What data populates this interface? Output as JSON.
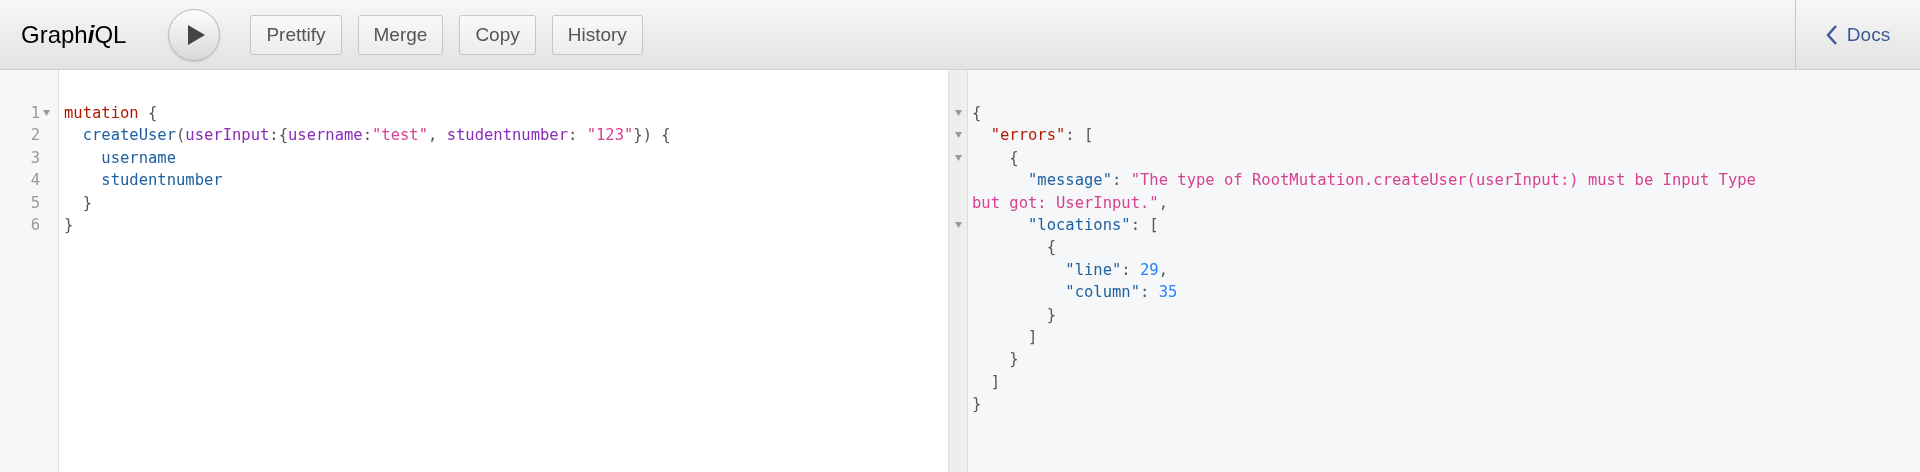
{
  "toolbar": {
    "title": [
      {
        "text": "Graph",
        "italic": false
      },
      {
        "text": "i",
        "italic": true
      },
      {
        "text": "QL",
        "italic": false
      }
    ],
    "buttons": [
      "Prettify",
      "Merge",
      "Copy",
      "History"
    ],
    "docs_link": "Docs"
  },
  "query_editor": {
    "lines": [
      {
        "number": "1",
        "foldable": true,
        "tokens": [
          {
            "text": "mutation",
            "kind": "keyword"
          },
          {
            "text": " {",
            "kind": "punct"
          }
        ]
      },
      {
        "number": "2",
        "foldable": false,
        "tokens": [
          {
            "text": "  createUser",
            "kind": "field"
          },
          {
            "text": "(",
            "kind": "punct"
          },
          {
            "text": "userInput",
            "kind": "attr"
          },
          {
            "text": ":{",
            "kind": "punct"
          },
          {
            "text": "username",
            "kind": "attr"
          },
          {
            "text": ":",
            "kind": "punct"
          },
          {
            "text": "\"test\"",
            "kind": "string"
          },
          {
            "text": ", ",
            "kind": "punct"
          },
          {
            "text": "studentnumber",
            "kind": "attr"
          },
          {
            "text": ": ",
            "kind": "punct"
          },
          {
            "text": "\"123\"",
            "kind": "string"
          },
          {
            "text": "}) {",
            "kind": "punct"
          }
        ]
      },
      {
        "number": "3",
        "foldable": false,
        "tokens": [
          {
            "text": "    username",
            "kind": "field"
          }
        ]
      },
      {
        "number": "4",
        "foldable": false,
        "tokens": [
          {
            "text": "    studentnumber",
            "kind": "field"
          }
        ]
      },
      {
        "number": "5",
        "foldable": false,
        "tokens": [
          {
            "text": "  }",
            "kind": "punct"
          }
        ]
      },
      {
        "number": "6",
        "foldable": false,
        "tokens": [
          {
            "text": "}",
            "kind": "punct"
          }
        ]
      }
    ]
  },
  "result": {
    "lines": [
      {
        "foldable": true,
        "tokens": [
          {
            "text": "{",
            "kind": "punct"
          }
        ]
      },
      {
        "foldable": true,
        "tokens": [
          {
            "text": "  \"errors\"",
            "kind": "keyword"
          },
          {
            "text": ": [",
            "kind": "punct"
          }
        ]
      },
      {
        "foldable": true,
        "tokens": [
          {
            "text": "    {",
            "kind": "punct"
          }
        ]
      },
      {
        "foldable": false,
        "tokens": [
          {
            "text": "      \"message\"",
            "kind": "field"
          },
          {
            "text": ": ",
            "kind": "punct"
          },
          {
            "text": "\"The type of RootMutation.createUser(userInput:) must be Input Type but got: UserInput.\"",
            "kind": "string"
          },
          {
            "text": ",",
            "kind": "punct"
          }
        ]
      },
      {
        "foldable": true,
        "tokens": [
          {
            "text": "      \"locations\"",
            "kind": "field"
          },
          {
            "text": ": [",
            "kind": "punct"
          }
        ]
      },
      {
        "foldable": false,
        "tokens": [
          {
            "text": "        {",
            "kind": "punct"
          }
        ]
      },
      {
        "foldable": false,
        "tokens": [
          {
            "text": "          \"line\"",
            "kind": "field"
          },
          {
            "text": ": ",
            "kind": "punct"
          },
          {
            "text": "29",
            "kind": "number"
          },
          {
            "text": ",",
            "kind": "punct"
          }
        ]
      },
      {
        "foldable": false,
        "tokens": [
          {
            "text": "          \"column\"",
            "kind": "field"
          },
          {
            "text": ": ",
            "kind": "punct"
          },
          {
            "text": "35",
            "kind": "number"
          }
        ]
      },
      {
        "foldable": false,
        "tokens": [
          {
            "text": "        }",
            "kind": "punct"
          }
        ]
      },
      {
        "foldable": false,
        "tokens": [
          {
            "text": "      ]",
            "kind": "punct"
          }
        ]
      },
      {
        "foldable": false,
        "tokens": [
          {
            "text": "    }",
            "kind": "punct"
          }
        ]
      },
      {
        "foldable": false,
        "tokens": [
          {
            "text": "  ]",
            "kind": "punct"
          }
        ]
      },
      {
        "foldable": false,
        "tokens": [
          {
            "text": "}",
            "kind": "punct"
          }
        ]
      }
    ]
  }
}
